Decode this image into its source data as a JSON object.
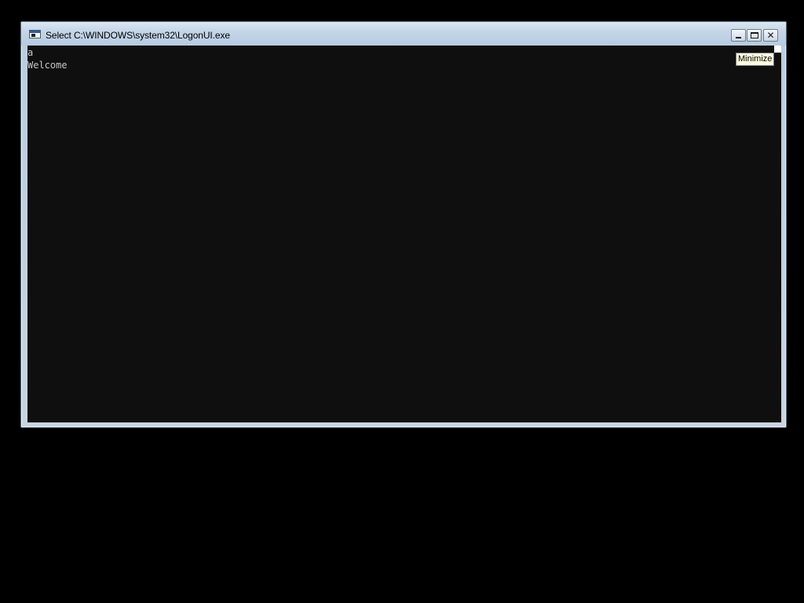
{
  "window": {
    "title": "Select C:\\WINDOWS\\system32\\LogonUI.exe",
    "icon": "console-window-icon",
    "controls": {
      "minimize_icon": "minimize-icon",
      "maximize_icon": "maximize-icon",
      "close_icon": "close-icon",
      "close_glyph": "✕"
    }
  },
  "console": {
    "lines": [
      "a",
      "Welcome"
    ],
    "background_color": "#0f0f0f",
    "text_color": "#c6c6c6"
  },
  "tooltip": {
    "text": "Minimize"
  }
}
